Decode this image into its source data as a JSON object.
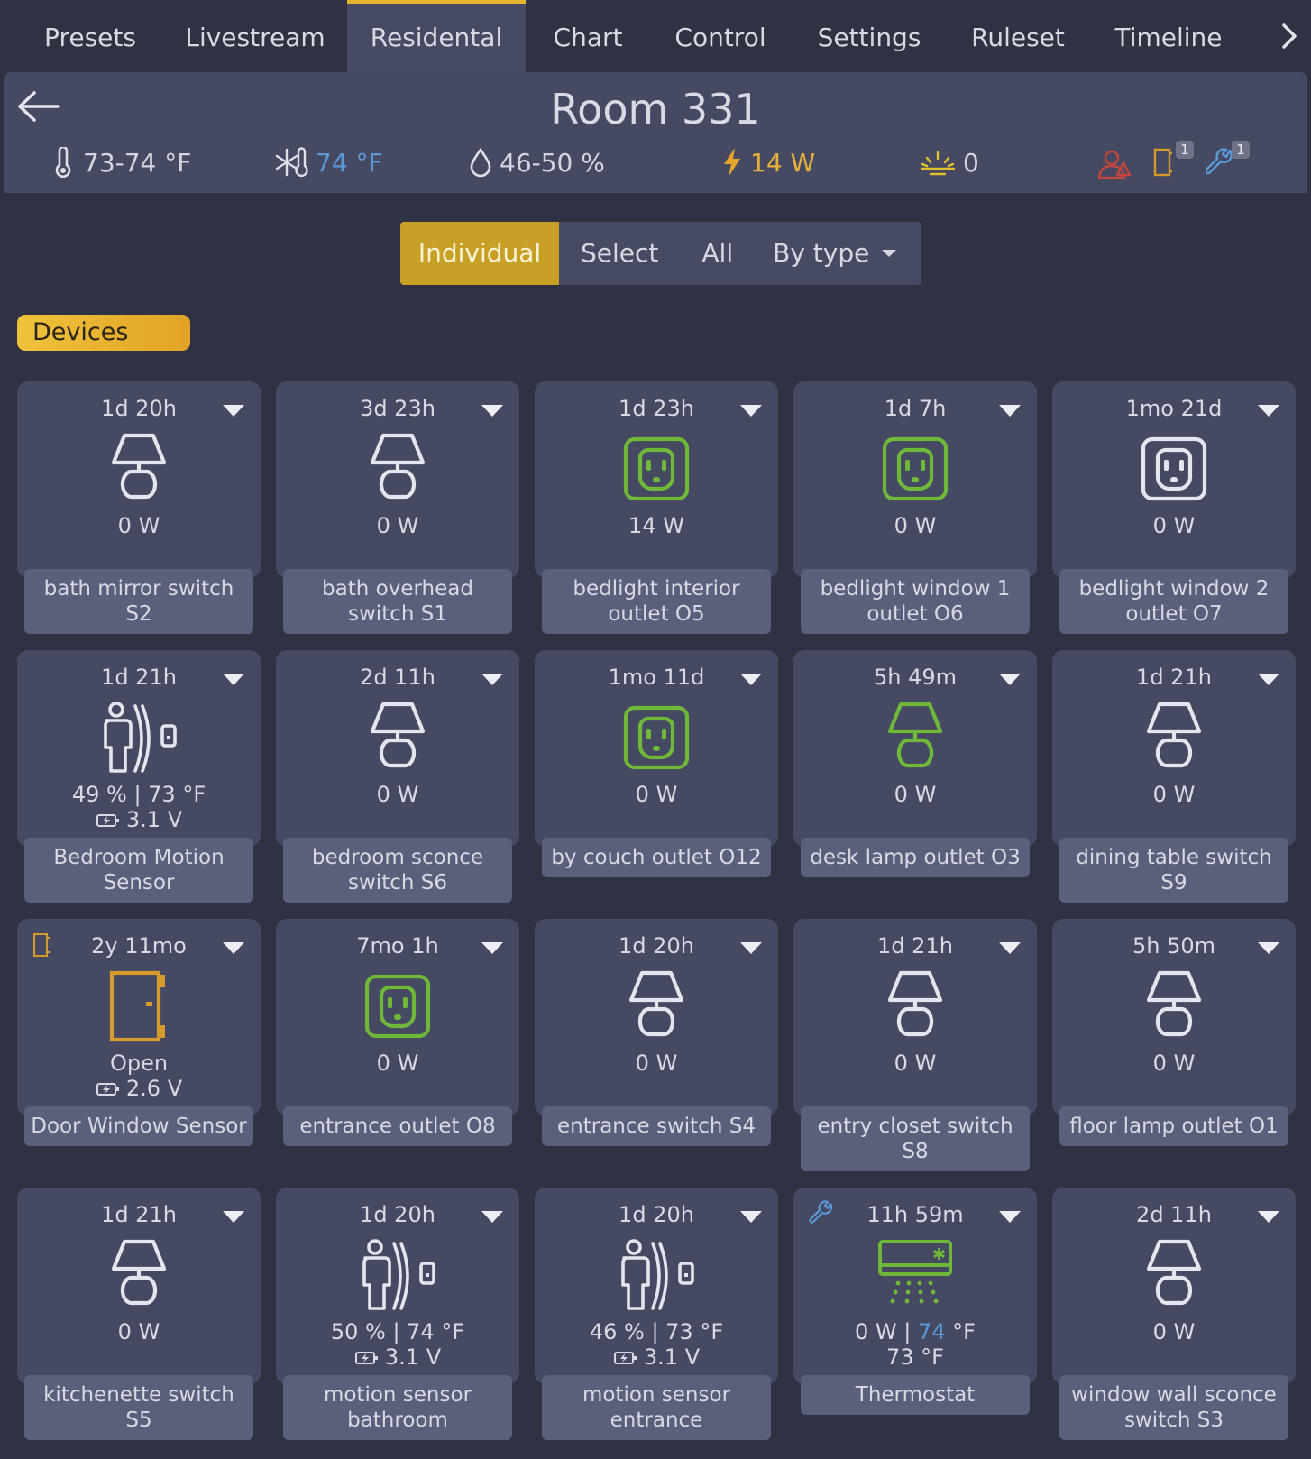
{
  "tabs": [
    "Presets",
    "Livestream",
    "Residental",
    "Chart",
    "Control",
    "Settings",
    "Ruleset",
    "Timeline"
  ],
  "active_tab": "Residental",
  "room": {
    "title": "Room 331",
    "temperature": "73-74 °F",
    "setpoint": "74 °F",
    "humidity": "46-50 %",
    "power": "14 W",
    "light": "0",
    "door_count": "1",
    "service_count": "1"
  },
  "view_modes": {
    "individual": "Individual",
    "select": "Select",
    "all": "All",
    "by_type": "By type"
  },
  "section_label": "Devices",
  "devices": [
    {
      "time": "1d 20h",
      "icon": "lamp-icon",
      "state": "off",
      "value": "0 W",
      "label": "bath mirror switch S2"
    },
    {
      "time": "3d 23h",
      "icon": "lamp-icon",
      "state": "off",
      "value": "0 W",
      "label": "bath overhead switch S1"
    },
    {
      "time": "1d 23h",
      "icon": "outlet-icon",
      "state": "on",
      "value": "14 W",
      "label": "bedlight interior outlet O5"
    },
    {
      "time": "1d 7h",
      "icon": "outlet-icon",
      "state": "on",
      "value": "0 W",
      "label": "bedlight window 1 outlet O6"
    },
    {
      "time": "1mo 21d",
      "icon": "outlet-icon",
      "state": "off",
      "value": "0 W",
      "label": "bedlight window 2 outlet O7"
    },
    {
      "time": "1d 21h",
      "icon": "motion-sensor-icon",
      "state": "off",
      "value": "49 % | 73 °F",
      "battery": "3.1 V",
      "label": "Bedroom Motion Sensor"
    },
    {
      "time": "2d 11h",
      "icon": "lamp-icon",
      "state": "off",
      "value": "0 W",
      "label": "bedroom sconce switch S6"
    },
    {
      "time": "1mo 11d",
      "icon": "outlet-icon",
      "state": "on",
      "value": "0 W",
      "label": "by couch outlet O12"
    },
    {
      "time": "5h 49m",
      "icon": "lamp-icon",
      "state": "on",
      "value": "0 W",
      "label": "desk lamp outlet O3"
    },
    {
      "time": "1d 21h",
      "icon": "lamp-icon",
      "state": "off",
      "value": "0 W",
      "label": "dining table switch S9"
    },
    {
      "time": "2y 11mo",
      "icon": "door-icon",
      "state": "open",
      "value": "Open",
      "battery": "2.6 V",
      "label": "Door Window Sensor"
    },
    {
      "time": "7mo 1h",
      "icon": "outlet-icon",
      "state": "on",
      "value": "0 W",
      "label": "entrance outlet O8"
    },
    {
      "time": "1d 20h",
      "icon": "lamp-icon",
      "state": "off",
      "value": "0 W",
      "label": "entrance switch S4"
    },
    {
      "time": "1d 21h",
      "icon": "lamp-icon",
      "state": "off",
      "value": "0 W",
      "label": "entry closet switch S8"
    },
    {
      "time": "5h 50m",
      "icon": "lamp-icon",
      "state": "off",
      "value": "0 W",
      "label": "floor lamp outlet O1"
    },
    {
      "time": "1d 21h",
      "icon": "lamp-icon",
      "state": "off",
      "value": "0 W",
      "label": "kitchenette switch S5"
    },
    {
      "time": "1d 20h",
      "icon": "motion-sensor-icon",
      "state": "off",
      "value": "50 % | 74 °F",
      "battery": "3.1 V",
      "label": "motion sensor bathroom"
    },
    {
      "time": "1d 20h",
      "icon": "motion-sensor-icon",
      "state": "off",
      "value": "46 % | 73 °F",
      "battery": "3.1 V",
      "label": "motion sensor entrance"
    },
    {
      "time": "11h 59m",
      "icon": "thermostat-icon",
      "state": "on",
      "value_power": "0 W |",
      "value_setpoint": "74",
      "value_unit": "°F",
      "value2": "73 °F",
      "label": "Thermostat"
    },
    {
      "time": "2d 11h",
      "icon": "lamp-icon",
      "state": "off",
      "value": "0 W",
      "label": "window wall sconce switch S3"
    }
  ],
  "colors": {
    "accent": "#e7b52b",
    "on": "#6fb83a",
    "off": "#e4e6ee",
    "cold": "#5b98d8",
    "hot": "#e6b13c",
    "alert": "#c2463c"
  }
}
